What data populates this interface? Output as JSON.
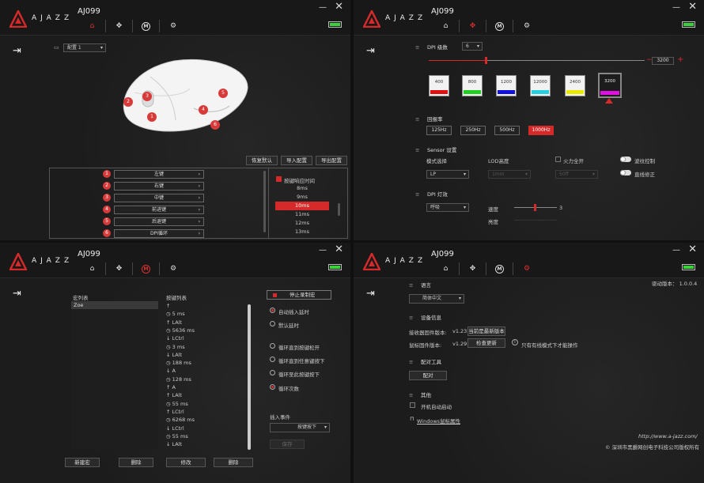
{
  "brand": "AJAZZ",
  "model": "AJ099",
  "nav": {
    "home": "⌂",
    "dpi": "✥",
    "macro": "M",
    "settings": "⚙"
  },
  "window": {
    "minimize": "—",
    "close": "✕"
  },
  "colors": {
    "accent": "#d62a2a",
    "battery": "#3ad13a"
  },
  "keys_panel": {
    "profile": "配置 1",
    "buttons": {
      "restore": "恢复默认",
      "import": "导入配置",
      "export": "导出配置"
    },
    "mouse_badges": [
      "1",
      "2",
      "3",
      "4",
      "5",
      "6"
    ],
    "keys": [
      {
        "num": "1",
        "label": "左键"
      },
      {
        "num": "2",
        "label": "右键"
      },
      {
        "num": "3",
        "label": "中键"
      },
      {
        "num": "4",
        "label": "前进键"
      },
      {
        "num": "5",
        "label": "后退键"
      },
      {
        "num": "6",
        "label": "DPI循环"
      }
    ],
    "debounce_label": "按键响应时间",
    "debounce_times": [
      "8ms",
      "9ms",
      "10ms",
      "11ms",
      "12ms",
      "13ms"
    ],
    "debounce_selected": "10ms"
  },
  "dpi_panel": {
    "dpi_level_label": "DPI 级数",
    "dpi_level_value": "6",
    "dpi_value": "3200",
    "minus": "−",
    "plus": "+",
    "levels": [
      {
        "value": "400",
        "color": "#e01010"
      },
      {
        "value": "800",
        "color": "#22d022"
      },
      {
        "value": "1200",
        "color": "#1010e0"
      },
      {
        "value": "12000",
        "color": "#22d0e0"
      },
      {
        "value": "2400",
        "color": "#e8e800"
      },
      {
        "value": "3200",
        "color": "#e010e0"
      }
    ],
    "polling_label": "回报率",
    "polling": [
      "125Hz",
      "250Hz",
      "500Hz",
      "1000Hz"
    ],
    "polling_selected": "1000Hz",
    "sensor_label": "Sensor 设置",
    "mode_label": "模式选择",
    "mode_value": "LP",
    "lod_label": "LOD高度",
    "lod_value": "1mm",
    "fire_label": "火力全开",
    "fire_value": "50ff",
    "ripple_label": "波纹控制",
    "angle_label": "直线修正",
    "light_label": "DPI 灯效",
    "light_mode": "呼吸",
    "speed_label": "速度",
    "speed_value": "3",
    "brightness_label": "亮度"
  },
  "macro_panel": {
    "macro_list_label": "宏列表",
    "macros": [
      "Zoe"
    ],
    "key_list_label": "按键列表",
    "events": [
      {
        "icon": "↑",
        "text": ""
      },
      {
        "icon": "◷",
        "text": "5 ms"
      },
      {
        "icon": "↑",
        "text": "LAlt"
      },
      {
        "icon": "◷",
        "text": "5636 ms"
      },
      {
        "icon": "↓",
        "text": "LCtrl"
      },
      {
        "icon": "◷",
        "text": "3 ms"
      },
      {
        "icon": "↓",
        "text": "LAlt"
      },
      {
        "icon": "◷",
        "text": "188 ms"
      },
      {
        "icon": "↓",
        "text": "A"
      },
      {
        "icon": "◷",
        "text": "128 ms"
      },
      {
        "icon": "↑",
        "text": "A"
      },
      {
        "icon": "↑",
        "text": "LAlt"
      },
      {
        "icon": "◷",
        "text": "55 ms"
      },
      {
        "icon": "↑",
        "text": "LCtrl"
      },
      {
        "icon": "◷",
        "text": "6268 ms"
      },
      {
        "icon": "↓",
        "text": "LCtrl"
      },
      {
        "icon": "◷",
        "text": "55 ms"
      },
      {
        "icon": "↓",
        "text": "LAlt"
      }
    ],
    "stop_record": "停止录制宏",
    "auto_delay": "自动插入延时",
    "default_delay": "默认延时",
    "loop_release": "循环直到按键松开",
    "loop_any": "循环直到任意键按下",
    "loop_press": "循环至此按键按下",
    "loop_count": "循环次数",
    "insert_label": "插入事件",
    "insert_value": "按键按下",
    "save": "保存",
    "new_macro": "新建宏",
    "delete_macro": "删除",
    "modify": "修改",
    "delete_key": "删除"
  },
  "settings_panel": {
    "language_label": "语言",
    "language_value": "简体中文",
    "driver_version": "驱动版本：  1.0.0.4",
    "device_info_label": "设备信息",
    "receiver_fw_label": "接收器固件版本:",
    "receiver_fw": "v1.23",
    "receiver_btn": "当前是最新版本",
    "mouse_fw_label": "鼠标固件版本:",
    "mouse_fw": "v1.29",
    "mouse_btn": "检查更新",
    "wired_note": "只有有线模式下才能操作",
    "pair_tool_label": "配对工具",
    "pair_btn": "配对",
    "other_label": "其他",
    "autostart": "开机自动启动",
    "windows_link": "Windows鼠标属性",
    "url": "http://www.a-jazz.com/",
    "copyright": "© 深圳市黑爵网创电子科技公司版权所有"
  }
}
